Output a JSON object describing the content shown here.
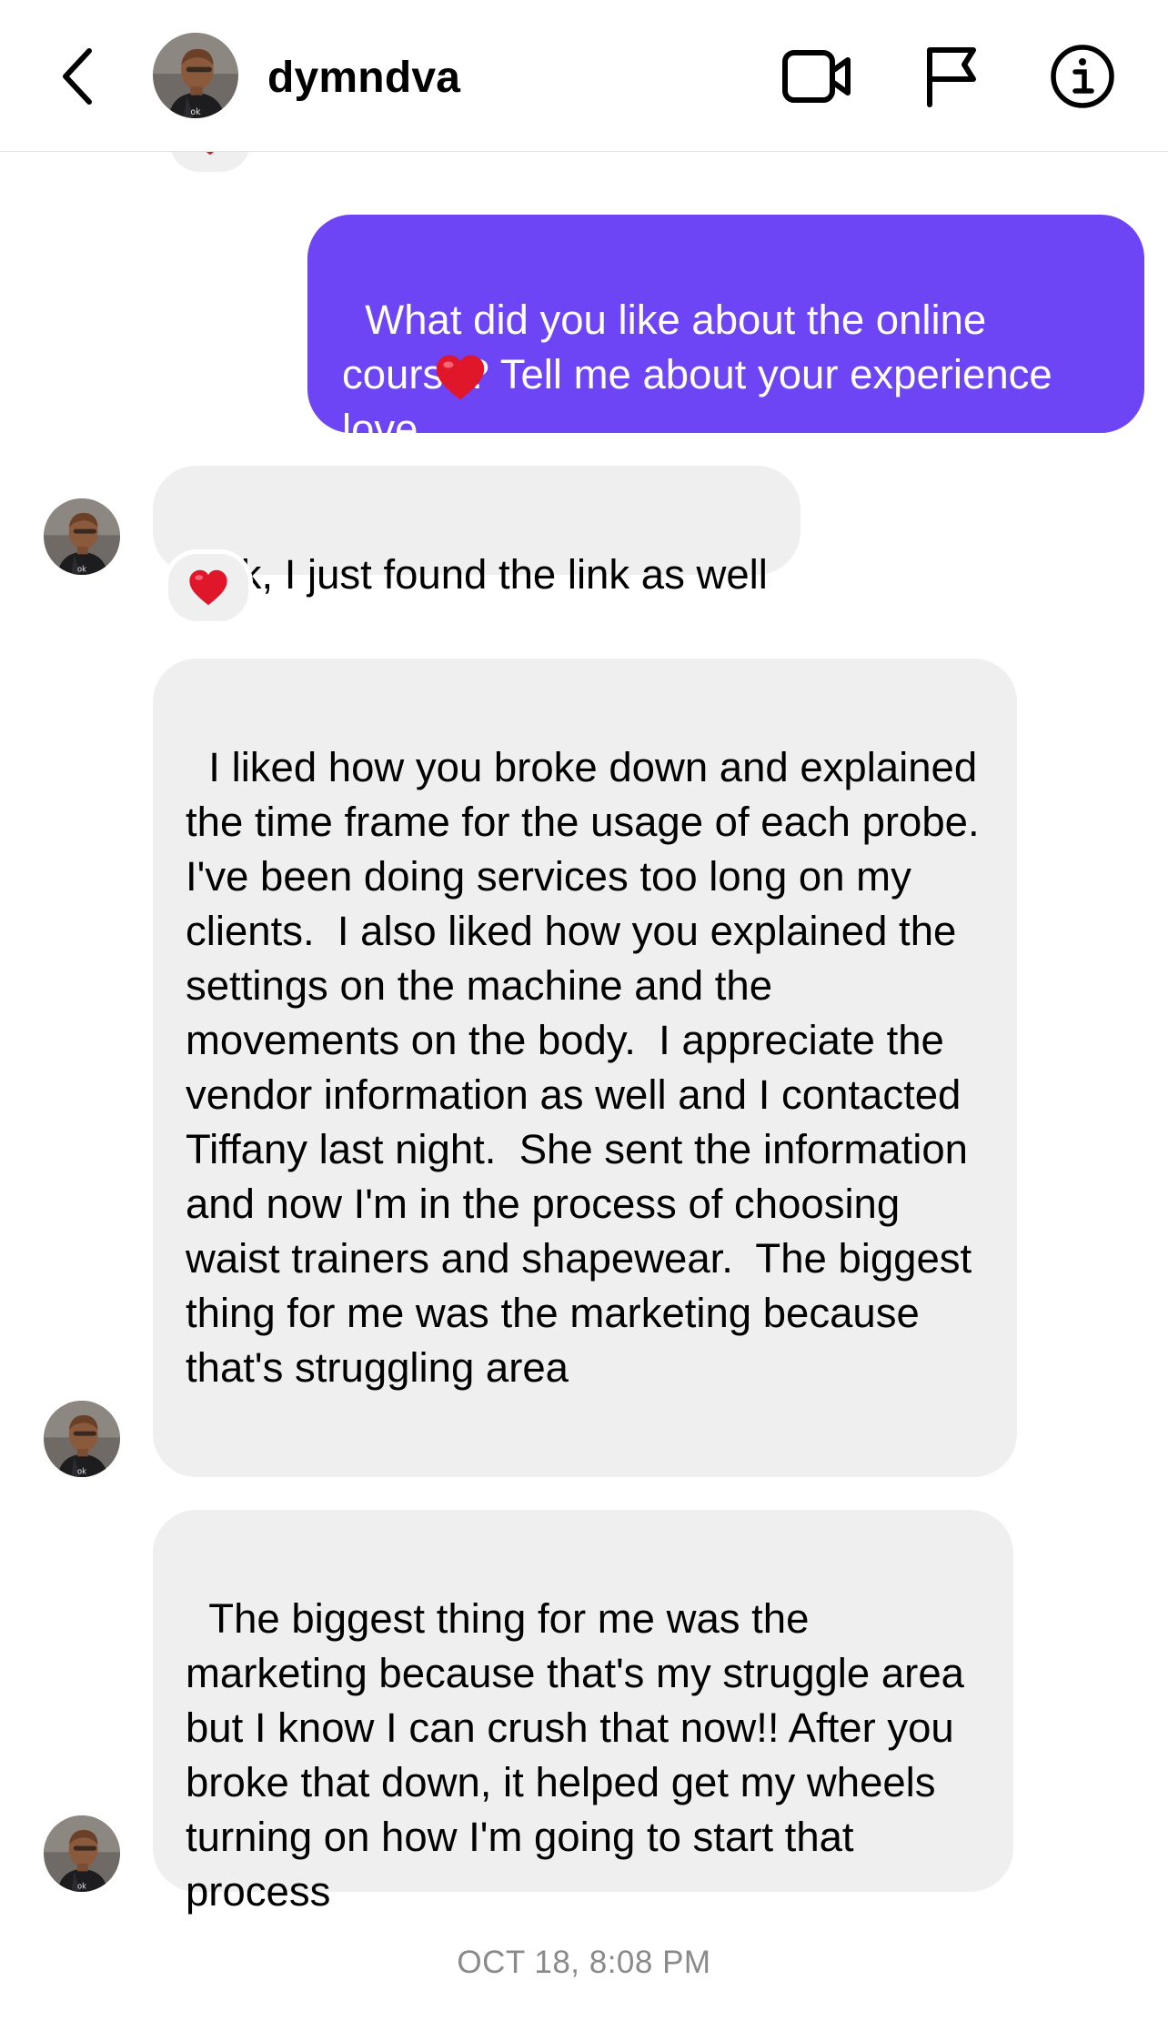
{
  "header": {
    "username": "dymndva",
    "back_icon": "chevron-left-icon",
    "video_icon": "video-camera-icon",
    "flag_icon": "flag-icon",
    "info_icon": "info-icon"
  },
  "messages": [
    {
      "direction": "outgoing",
      "text": "What did you like about the online course? Tell me about your experience love",
      "emoji": "heart"
    },
    {
      "direction": "incoming",
      "text": "Ok, I just found the link as well",
      "reaction": "heart"
    },
    {
      "direction": "incoming",
      "text": "I liked how you broke down and explained the time frame for the usage of each probe.  I've been doing services too long on my clients.  I also liked how you explained the settings on the machine and the movements on the body.  I appreciate the vendor information as well and I contacted Tiffany last night.  She sent the information and now I'm in the process of choosing waist trainers and shapewear.  The biggest thing for me was the marketing because that's struggling area"
    },
    {
      "direction": "incoming",
      "text": "The biggest thing for me was the marketing because that's my struggle area but I know I can crush that now!! After you broke that down, it helped get my wheels turning on how I'm going to start that process"
    }
  ],
  "timestamp": "OCT 18, 8:08 PM",
  "colors": {
    "outgoing_bubble": "#6e45f5",
    "incoming_bubble": "#efefef",
    "reaction_heart": "#e0162b",
    "timestamp": "#8a8a8a"
  }
}
